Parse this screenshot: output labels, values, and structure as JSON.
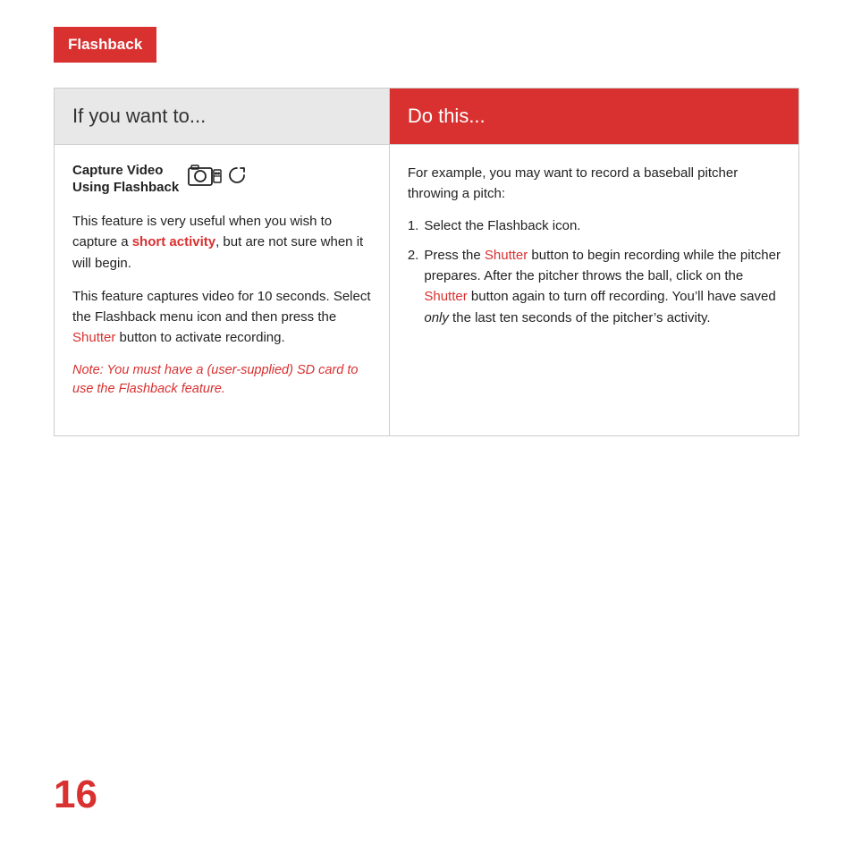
{
  "header": {
    "title": "Flashback"
  },
  "table": {
    "col_left_heading": "If you want to...",
    "col_right_heading": "Do this...",
    "left": {
      "capture_heading_line1": "Capture Video",
      "capture_heading_line2": "Using Flashback",
      "para1_before": "This feature is very useful when you wish to capture a ",
      "para1_bold_red": "short activity",
      "para1_after": ", but are not sure when it will begin.",
      "para2_before": "This feature captures video for 10 seconds. Select the Flashback menu icon and then press the ",
      "para2_red": "Shutter",
      "para2_after": " button to activate recording.",
      "note": "Note: You must have a (user-supplied) SD card to use the Flashback feature."
    },
    "right": {
      "intro": "For example, you may want to record a baseball pitcher throwing a pitch:",
      "item1": "Select the Flashback icon.",
      "item2_before": "Press the ",
      "item2_red1": "Shutter",
      "item2_middle": " button to begin recording while the pitcher prepares. After the pitcher throws the ball, click on the ",
      "item2_red2": "Shutter",
      "item2_after": " button again to turn off recording. You’ll have saved ",
      "item2_italic": "only",
      "item2_end": " the last ten seconds of the pitcher’s activity."
    }
  },
  "page_number": "16"
}
